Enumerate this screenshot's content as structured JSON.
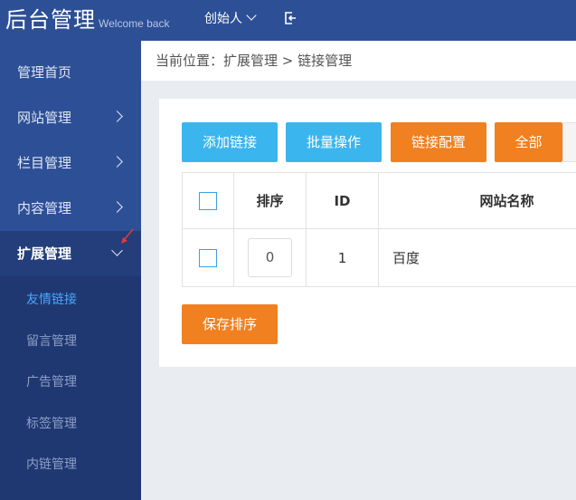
{
  "header": {
    "logo": "后台管理",
    "welcome": "Welcome back",
    "user": "创始人",
    "icons": [
      "chevron-down-icon",
      "logout-icon"
    ]
  },
  "sidebar": {
    "items": [
      {
        "label": "管理首页"
      },
      {
        "label": "网站管理"
      },
      {
        "label": "栏目管理"
      },
      {
        "label": "内容管理"
      },
      {
        "label": "扩展管理"
      }
    ],
    "subitems": [
      {
        "label": "友情链接"
      },
      {
        "label": "留言管理"
      },
      {
        "label": "广告管理"
      },
      {
        "label": "标签管理"
      },
      {
        "label": "内链管理"
      }
    ]
  },
  "breadcrumb": "当前位置：扩展管理 > 链接管理",
  "toolbar": {
    "add": "添加链接",
    "batch": "批量操作",
    "config": "链接配置",
    "all": "全部"
  },
  "table": {
    "headers": [
      "排序",
      "ID",
      "网站名称"
    ],
    "rows": [
      {
        "sort": "0",
        "id": "1",
        "name": "百度"
      }
    ]
  },
  "save_label": "保存排序",
  "colors": {
    "sidebar": "#2d4f95",
    "sidebar_active": "#233e7a",
    "blue_button": "#3ab5ee",
    "orange_button": "#f08020",
    "active_link": "#4aa6ff"
  }
}
